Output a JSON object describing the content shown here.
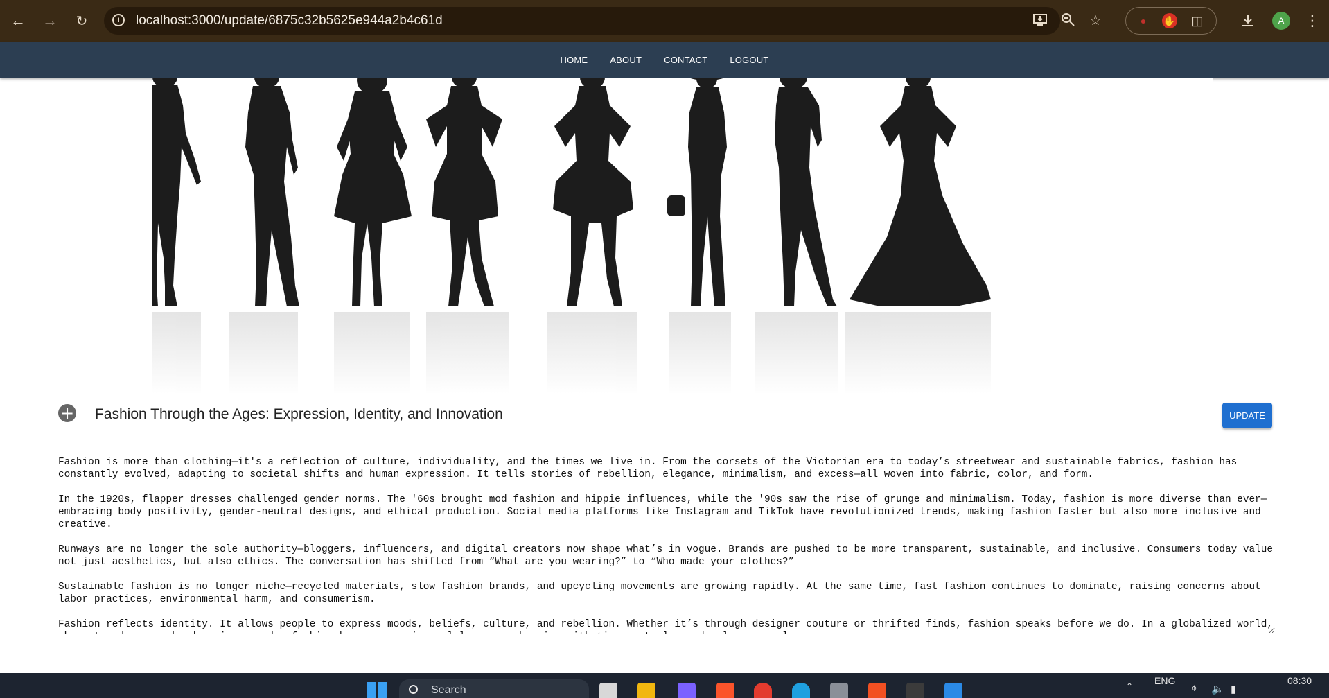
{
  "browser": {
    "url": "localhost:3000/update/6875c32b5625e944a2b4c61d",
    "avatar_letter": "A",
    "icons": {
      "back": "back-arrow-icon",
      "forward": "forward-arrow-icon",
      "reload": "reload-icon",
      "site_info": "info-icon",
      "install": "install-app-icon",
      "zoom": "zoom-icon",
      "bookmark": "star-icon",
      "extensions": "puzzle-icon",
      "download": "download-icon",
      "menu": "kebab-menu-icon"
    }
  },
  "navbar": {
    "links": [
      "HOME",
      "ABOUT",
      "CONTACT",
      "LOGOUT"
    ],
    "background": "#2c3e52"
  },
  "post": {
    "title": "Fashion Through the Ages: Expression, Identity, and Innovation",
    "update_label": "UPDATE",
    "content": "Fashion is more than clothing—it's a reflection of culture, individuality, and the times we live in. From the corsets of the Victorian era to today’s streetwear and sustainable fabrics, fashion has constantly evolved, adapting to societal shifts and human expression. It tells stories of rebellion, elegance, minimalism, and excess—all woven into fabric, color, and form.\n\nIn the 1920s, flapper dresses challenged gender norms. The '60s brought mod fashion and hippie influences, while the '90s saw the rise of grunge and minimalism. Today, fashion is more diverse than ever—embracing body positivity, gender-neutral designs, and ethical production. Social media platforms like Instagram and TikTok have revolutionized trends, making fashion faster but also more inclusive and creative.\n\nRunways are no longer the sole authority—bloggers, influencers, and digital creators now shape what’s in vogue. Brands are pushed to be more transparent, sustainable, and inclusive. Consumers today value not just aesthetics, but also ethics. The conversation has shifted from “What are you wearing?” to “Who made your clothes?”\n\nSustainable fashion is no longer niche—recycled materials, slow fashion brands, and upcycling movements are growing rapidly. At the same time, fast fashion continues to dominate, raising concerns about labor practices, environmental harm, and consumerism.\n\nFashion reflects identity. It allows people to express moods, beliefs, culture, and rebellion. Whether it’s through designer couture or thrifted finds, fashion speaks before we do. In a globalized world, where trends cross borders in seconds, fashion becomes a universal language—changing with time, yet always deeply personal.",
    "accent": "#1f6fd0"
  },
  "taskbar": {
    "search_placeholder": "Search",
    "language": "ENG",
    "time": "08:30"
  }
}
